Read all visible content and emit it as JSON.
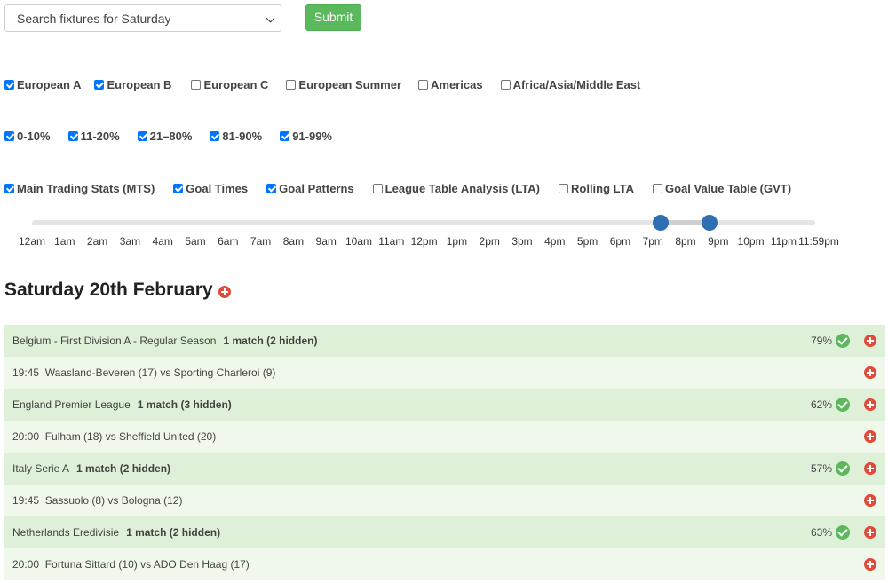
{
  "search": {
    "value": "Search fixtures for Saturday",
    "submit_label": "Submit"
  },
  "regions": [
    {
      "label": "European A",
      "checked": true
    },
    {
      "label": "European B",
      "checked": true
    },
    {
      "label": "European C",
      "checked": false
    },
    {
      "label": "European Summer",
      "checked": false
    },
    {
      "label": "Americas",
      "checked": false
    },
    {
      "label": "Africa/Asia/Middle East",
      "checked": false
    }
  ],
  "ranges": [
    {
      "label": "0-10%",
      "checked": true
    },
    {
      "label": "11-20%",
      "checked": true
    },
    {
      "label": "21–80%",
      "checked": true
    },
    {
      "label": "81-90%",
      "checked": true
    },
    {
      "label": "91-99%",
      "checked": true
    }
  ],
  "stats": [
    {
      "label": "Main Trading Stats (MTS)",
      "checked": true
    },
    {
      "label": "Goal Times",
      "checked": true
    },
    {
      "label": "Goal Patterns",
      "checked": true
    },
    {
      "label": "League Table Analysis (LTA)",
      "checked": false
    },
    {
      "label": "Rolling LTA",
      "checked": false
    },
    {
      "label": "Goal Value Table (GVT)",
      "checked": false
    }
  ],
  "time_slider": {
    "ticks": [
      "12am",
      "1am",
      "2am",
      "3am",
      "4am",
      "5am",
      "6am",
      "7am",
      "8am",
      "9am",
      "10am",
      "11am",
      "12pm",
      "1pm",
      "2pm",
      "3pm",
      "4pm",
      "5pm",
      "6pm",
      "7pm",
      "8pm",
      "9pm",
      "10pm",
      "11pm",
      "11:59pm"
    ],
    "from": "7pm",
    "to": "9pm"
  },
  "day_heading": "Saturday 20th February",
  "fixtures": [
    {
      "type": "league",
      "name": "Belgium - First Division A - Regular Season",
      "count": "1 match (2 hidden)",
      "pct": "79%"
    },
    {
      "type": "match",
      "text": "19:45  Waasland-Beveren (17) vs Sporting Charleroi (9)"
    },
    {
      "type": "league",
      "name": "England Premier League",
      "count": "1 match (3 hidden)",
      "pct": "62%"
    },
    {
      "type": "match",
      "text": "20:00  Fulham (18) vs Sheffield United (20)"
    },
    {
      "type": "league",
      "name": "Italy Serie A",
      "count": "1 match (2 hidden)",
      "pct": "57%"
    },
    {
      "type": "match",
      "text": "19:45  Sassuolo (8) vs Bologna (12)"
    },
    {
      "type": "league",
      "name": "Netherlands Eredivisie",
      "count": "1 match (2 hidden)",
      "pct": "63%"
    },
    {
      "type": "match",
      "text": "20:00  Fortuna Sittard (10) vs ADO Den Haag (17)"
    }
  ],
  "colors": {
    "league_bg": "#dff0d8",
    "match_bg": "#f0f8ec",
    "accent": "#2e6fb3",
    "submit": "#5cb85c",
    "add": "#e04b3c"
  }
}
